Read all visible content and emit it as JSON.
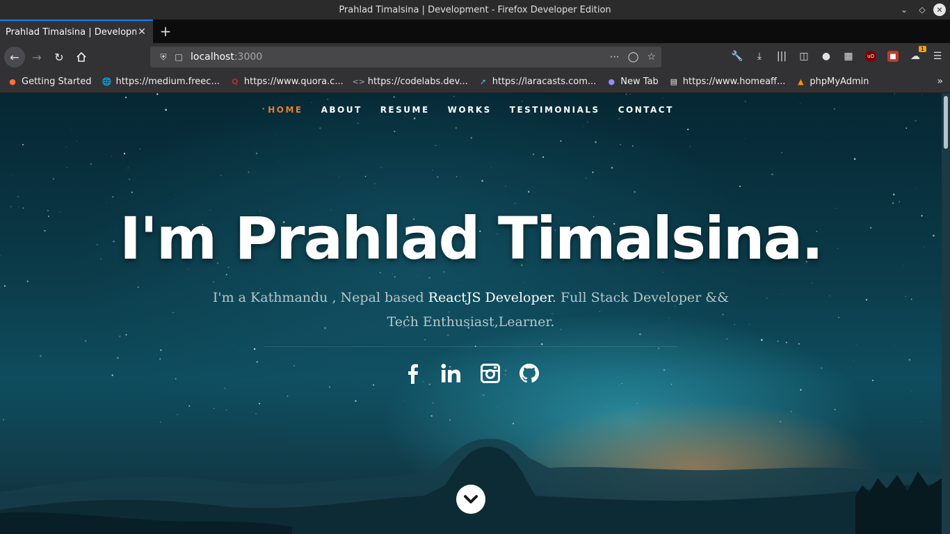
{
  "window": {
    "title": "Prahlad Timalsina | Development - Firefox Developer Edition"
  },
  "tabs": [
    {
      "label": "Prahlad Timalsina | Developm"
    }
  ],
  "urlbar": {
    "host": "localhost",
    "port": ":3000"
  },
  "bookmarks": [
    {
      "label": "Getting Started",
      "icon": "firefox-icon"
    },
    {
      "label": "https://medium.freec...",
      "icon": "globe-icon"
    },
    {
      "label": "https://www.quora.c...",
      "icon": "quora-icon"
    },
    {
      "label": "https://codelabs.dev...",
      "icon": "code-icon"
    },
    {
      "label": "https://laracasts.com...",
      "icon": "laracasts-icon"
    },
    {
      "label": "New Tab",
      "icon": "firefox-icon"
    },
    {
      "label": "https://www.homeaff...",
      "icon": "page-icon"
    },
    {
      "label": "phpMyAdmin",
      "icon": "phpmyadmin-icon"
    }
  ],
  "site": {
    "nav": [
      "HOME",
      "ABOUT",
      "RESUME",
      "WORKS",
      "TESTIMONIALS",
      "CONTACT"
    ],
    "active_nav": "HOME",
    "accent_color": "#e87f2e",
    "hero_title": "I'm Prahlad Timalsina.",
    "hero_sub_pre": "I'm a Kathmandu , Nepal based ",
    "hero_sub_highlight": "ReactJS Developer",
    "hero_sub_post": ". Full Stack Developer && Tech Enthusiast,Learner.",
    "social": [
      "facebook-icon",
      "linkedin-icon",
      "instagram-icon",
      "github-icon"
    ]
  },
  "toolbar_badge": "1"
}
